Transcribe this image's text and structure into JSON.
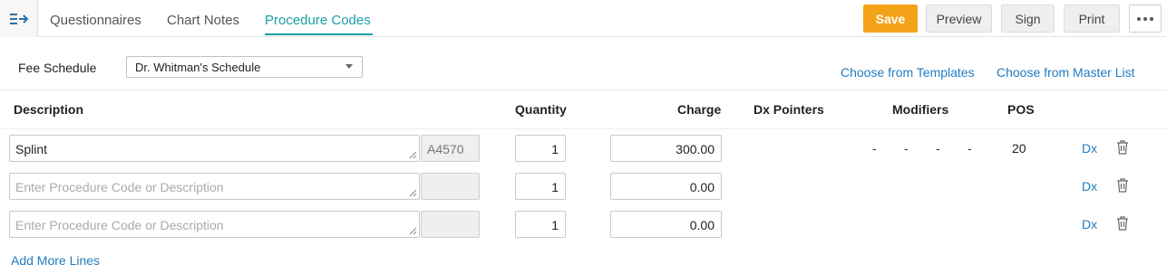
{
  "header": {
    "tabs": [
      {
        "label": "Questionnaires"
      },
      {
        "label": "Chart Notes"
      },
      {
        "label": "Procedure Codes"
      }
    ],
    "active_tab": "Procedure Codes",
    "buttons": {
      "save": "Save",
      "preview": "Preview",
      "sign": "Sign",
      "print": "Print"
    },
    "menu_icon": "sidebar-expand-icon",
    "more_icon": "more-horizontal-icon"
  },
  "fee_schedule": {
    "label": "Fee Schedule",
    "selected": "Dr. Whitman's Schedule"
  },
  "links": {
    "templates": "Choose from Templates",
    "master_list": "Choose from Master List",
    "add_more": "Add More Lines"
  },
  "columns": {
    "description": "Description",
    "quantity": "Quantity",
    "charge": "Charge",
    "dx_pointers": "Dx Pointers",
    "modifiers": "Modifiers",
    "pos": "POS"
  },
  "rows": [
    {
      "description": "Splint",
      "code": "A4570",
      "quantity": "1",
      "charge": "300.00",
      "modifiers": [
        "-",
        "-",
        "-",
        "-"
      ],
      "pos": "20",
      "dx": "Dx"
    },
    {
      "description": "",
      "placeholder": "Enter Procedure Code or Description",
      "code": "",
      "quantity": "1",
      "charge": "0.00",
      "dx": "Dx"
    },
    {
      "description": "",
      "placeholder": "Enter Procedure Code or Description",
      "code": "",
      "quantity": "1",
      "charge": "0.00",
      "dx": "Dx"
    }
  ],
  "colors": {
    "accent": "#1a9ea6",
    "save": "#f5a21b",
    "link": "#1f7bc1"
  }
}
